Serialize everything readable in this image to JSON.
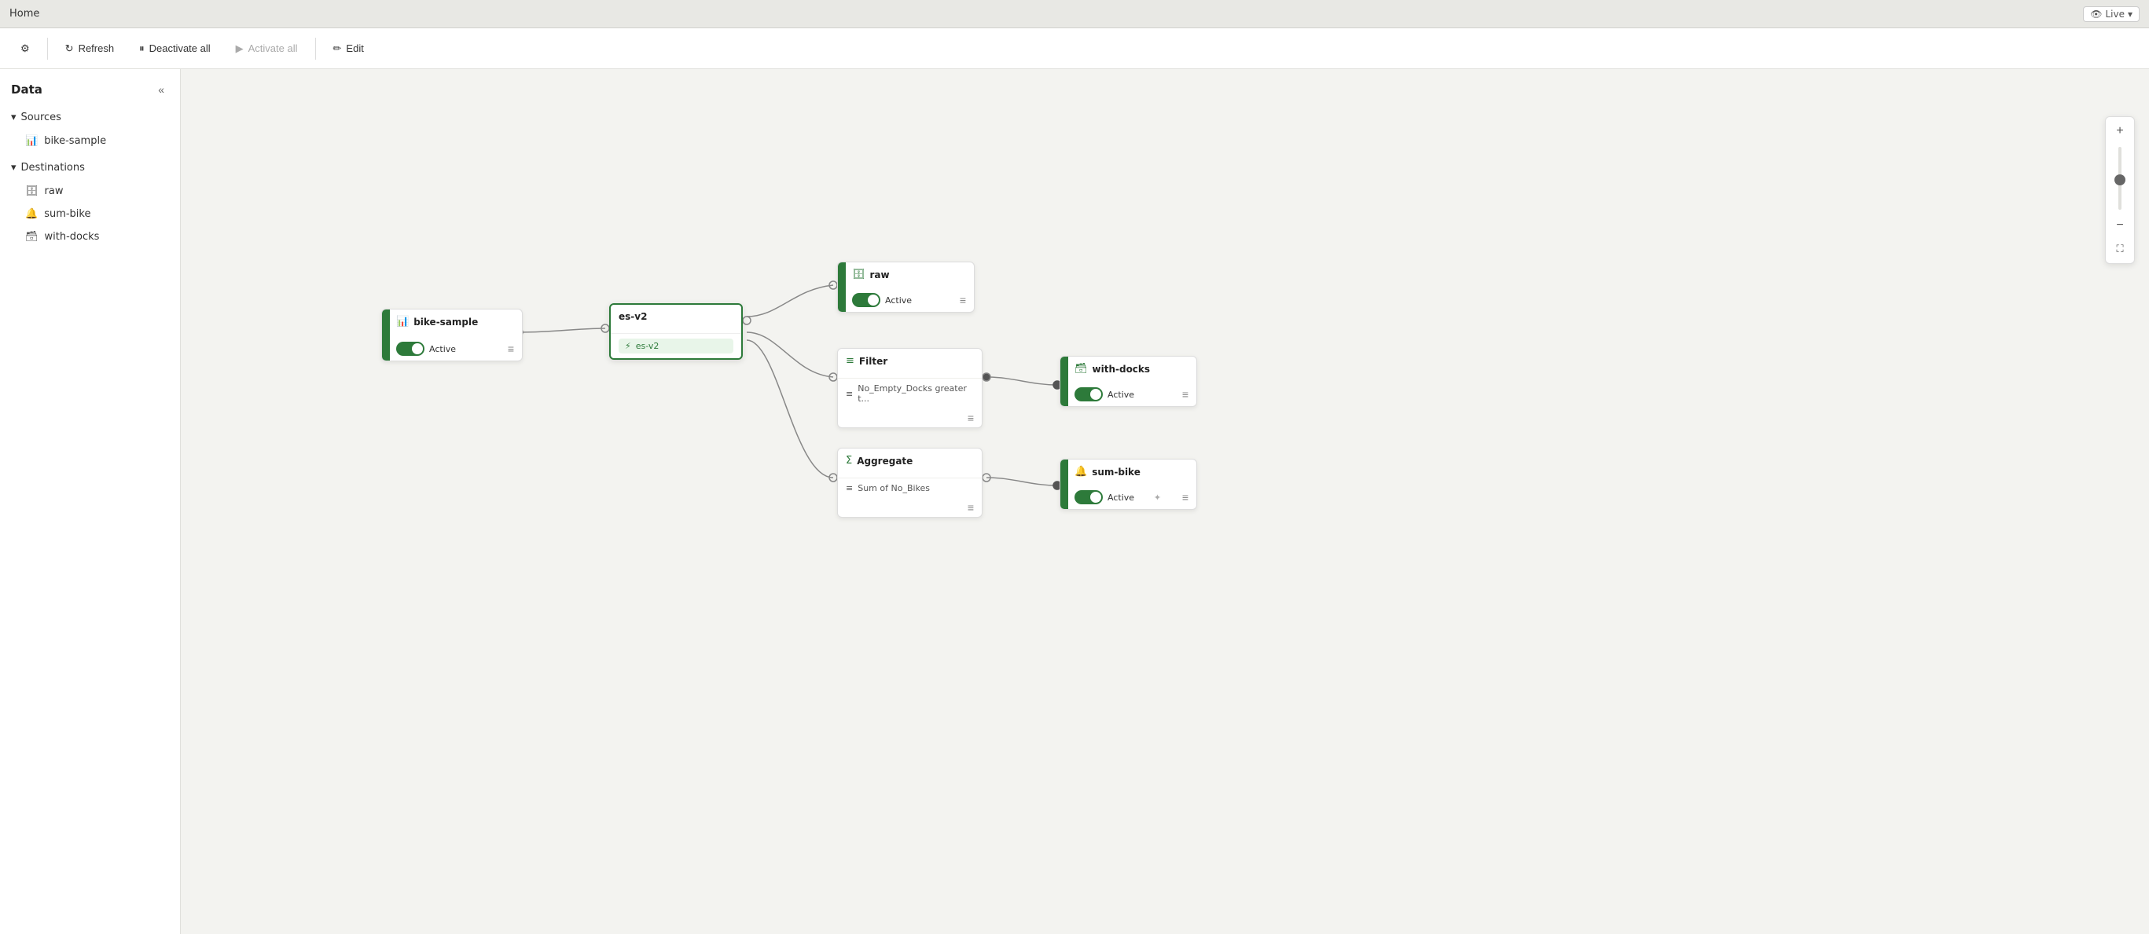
{
  "titlebar": {
    "title": "Home",
    "live_label": "Live",
    "live_dropdown": true
  },
  "toolbar": {
    "settings_icon": "⚙",
    "refresh_label": "Refresh",
    "refresh_icon": "↻",
    "deactivate_label": "Deactivate all",
    "deactivate_icon": "⏸",
    "activate_label": "Activate all",
    "activate_icon": "▶",
    "edit_label": "Edit",
    "edit_icon": "✏"
  },
  "sidebar": {
    "title": "Data",
    "collapse_icon": "«",
    "sources_label": "Sources",
    "sources_items": [
      {
        "label": "bike-sample",
        "icon": "📊"
      }
    ],
    "destinations_label": "Destinations",
    "destinations_items": [
      {
        "label": "raw",
        "icon": "🗄"
      },
      {
        "label": "sum-bike",
        "icon": "🔔"
      },
      {
        "label": "with-docks",
        "icon": "🗃"
      }
    ]
  },
  "nodes": {
    "source": {
      "title": "bike-sample",
      "icon": "📊",
      "toggle_active": true,
      "toggle_label": "Active"
    },
    "es": {
      "title": "es-v2",
      "tag_label": "es-v2",
      "tag_icon": "⚡"
    },
    "raw_dest": {
      "title": "raw",
      "icon": "🗄",
      "toggle_active": true,
      "toggle_label": "Active"
    },
    "filter_transform": {
      "title": "Filter",
      "row_icon": "≡",
      "row_text": "No_Empty_Docks greater t..."
    },
    "with_docks_dest": {
      "title": "with-docks",
      "icon": "🗃",
      "toggle_active": true,
      "toggle_label": "Active"
    },
    "aggregate_transform": {
      "title": "Aggregate",
      "row_icon": "Σ",
      "row_text": "Sum of No_Bikes"
    },
    "sum_bike_dest": {
      "title": "sum-bike",
      "icon": "🔔",
      "toggle_active": true,
      "toggle_label": "Active"
    }
  },
  "zoom": {
    "plus_label": "+",
    "minus_label": "−",
    "fit_label": "⛶"
  }
}
